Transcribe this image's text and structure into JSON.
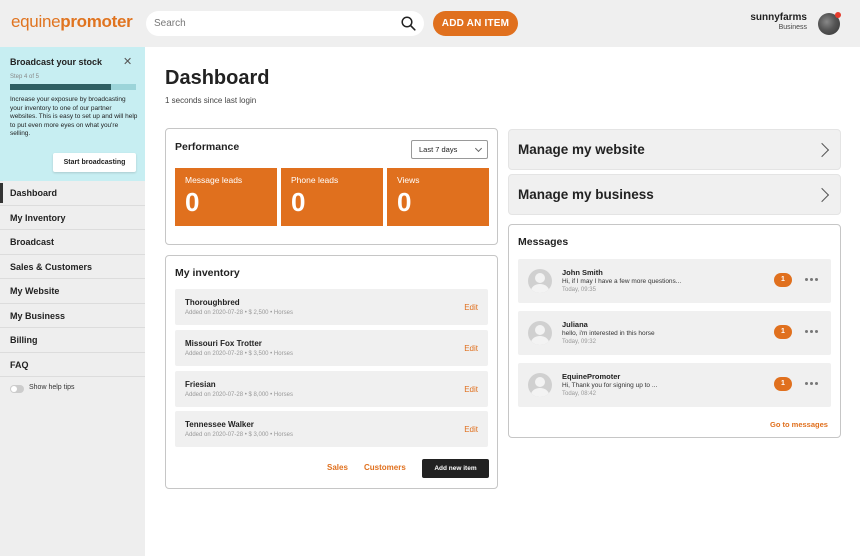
{
  "header": {
    "logo_part1": "equine",
    "logo_part2": "promoter",
    "search_placeholder": "Search",
    "add_item_label": "ADD AN ITEM",
    "user_name": "sunnyfarms",
    "user_type": "Business"
  },
  "promo": {
    "title": "Broadcast your stock",
    "close": "✕",
    "step": "Step 4 of 5",
    "progress_fraction": 0.8,
    "text": "Increase your exposure by broadcasting your inventory to one of our partner websites. This is easy to set up and will help to put even more eyes on what you're selling.",
    "button": "Start broadcasting"
  },
  "sidebar": {
    "items": [
      {
        "label": "Dashboard",
        "active": true
      },
      {
        "label": "My Inventory"
      },
      {
        "label": "Broadcast"
      },
      {
        "label": "Sales & Customers"
      },
      {
        "label": "My Website"
      },
      {
        "label": "My Business"
      },
      {
        "label": "Billing"
      },
      {
        "label": "FAQ"
      }
    ],
    "help_tips_label": "Show help tips"
  },
  "main": {
    "title": "Dashboard",
    "subtitle": "1 seconds since last login"
  },
  "performance": {
    "title": "Performance",
    "range": "Last 7 days",
    "stats": [
      {
        "label": "Message leads",
        "value": "0"
      },
      {
        "label": "Phone leads",
        "value": "0"
      },
      {
        "label": "Views",
        "value": "0"
      }
    ]
  },
  "inventory": {
    "title": "My inventory",
    "items": [
      {
        "name": "Thoroughbred",
        "meta": "Added on 2020-07-28 •  $ 2,500 • Horses",
        "edit": "Edit"
      },
      {
        "name": "Missouri Fox Trotter",
        "meta": "Added on 2020-07-28 •  $ 3,500 • Horses",
        "edit": "Edit"
      },
      {
        "name": "Friesian",
        "meta": "Added on 2020-07-28 •  $ 8,000 • Horses",
        "edit": "Edit"
      },
      {
        "name": "Tennessee Walker",
        "meta": "Added on 2020-07-28 •  $ 3,000 • Horses",
        "edit": "Edit"
      }
    ],
    "sales_link": "Sales",
    "customers_link": "Customers",
    "add_new_label": "Add new item"
  },
  "manage": {
    "website": "Manage my website",
    "business": "Manage my business"
  },
  "messages": {
    "title": "Messages",
    "items": [
      {
        "name": "John Smith",
        "text": "Hi, if I may I have a few more questions...",
        "time": "Today, 09:35",
        "count": "1"
      },
      {
        "name": "Juliana",
        "text": "hello, i'm interested in this horse",
        "time": "Today, 09:32",
        "count": "1"
      },
      {
        "name": "EquinePromoter",
        "text": "Hi, Thank you for signing up to ...",
        "time": "Today, 08:42",
        "count": "1"
      }
    ],
    "go_to_label": "Go to messages"
  },
  "colors": {
    "accent": "#e0701e",
    "promo_bg": "#c7eef2"
  }
}
